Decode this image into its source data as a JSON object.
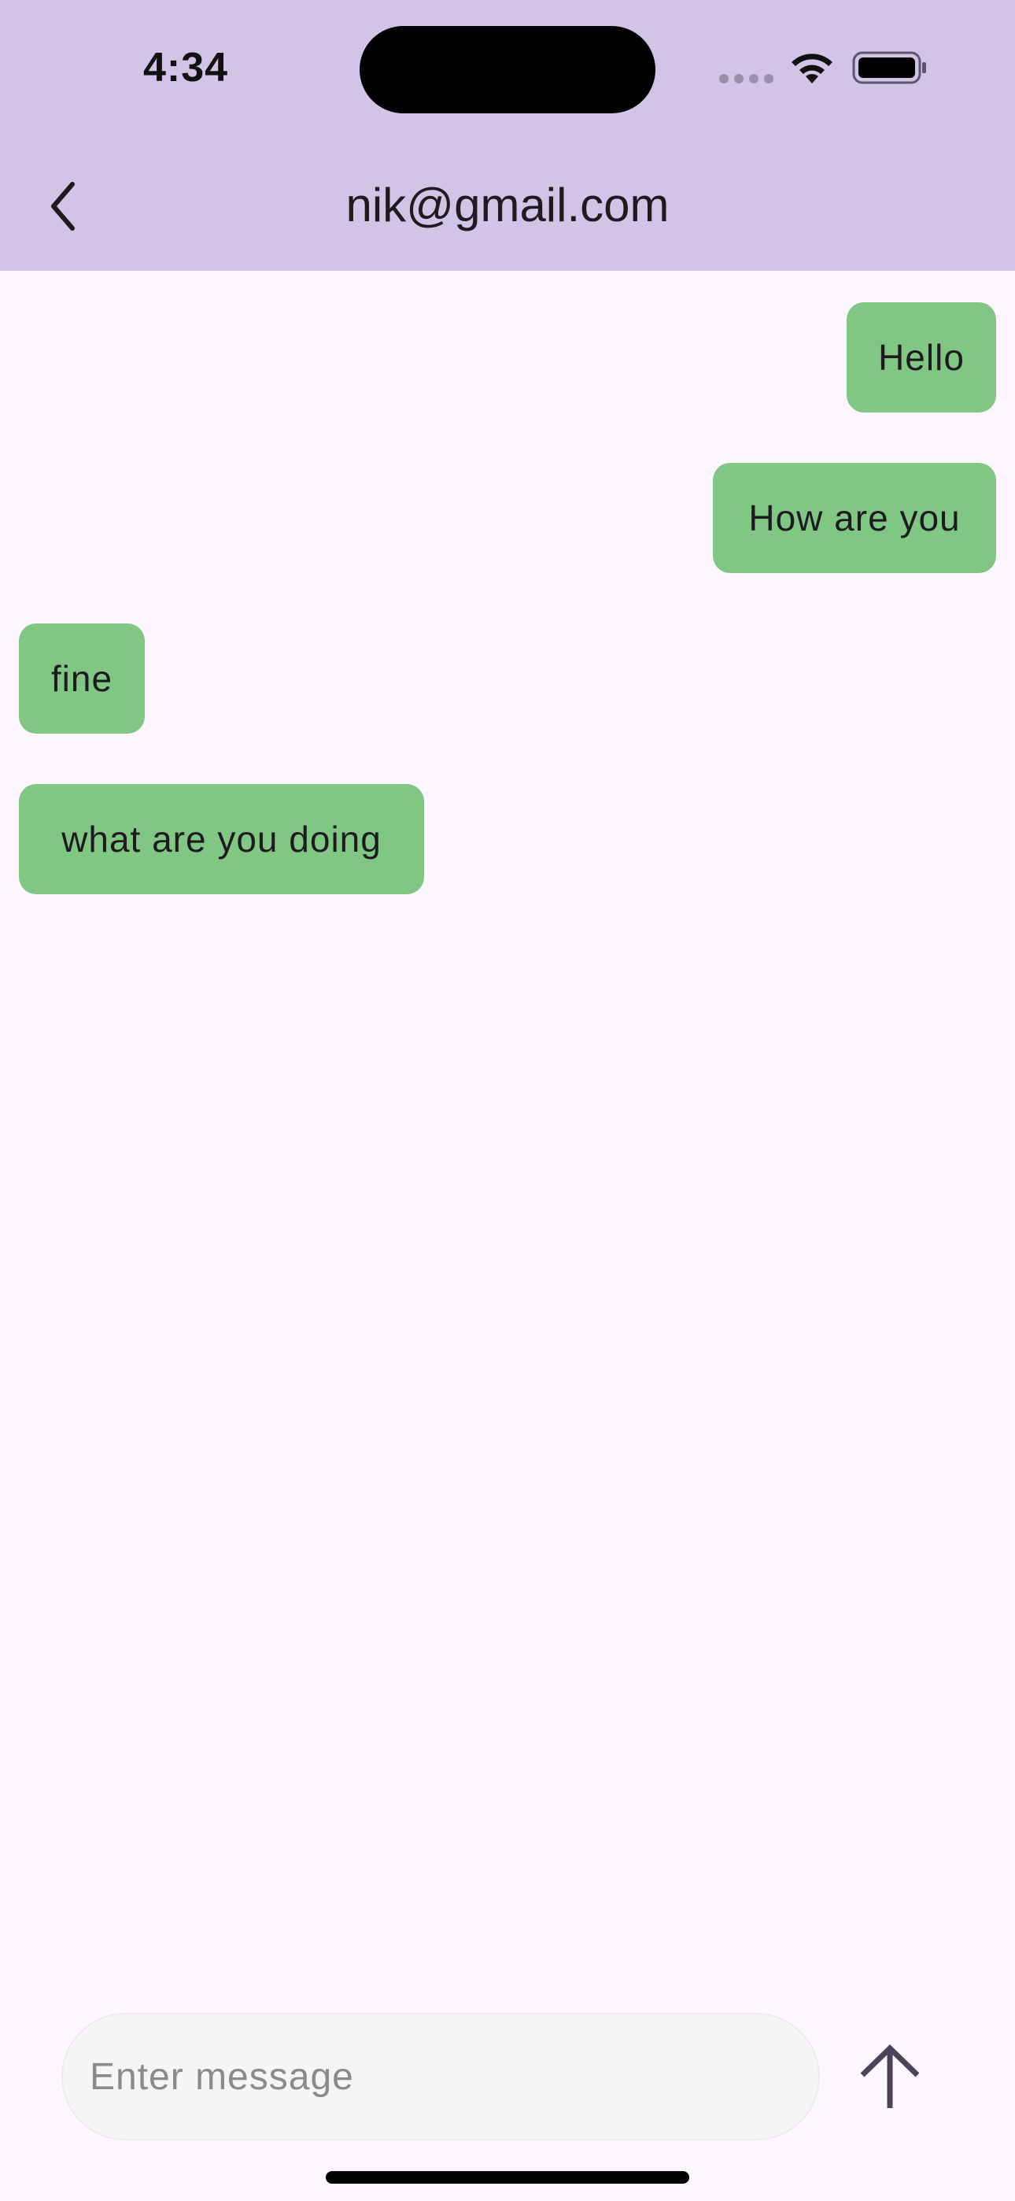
{
  "status_bar": {
    "time": "4:34"
  },
  "header": {
    "title": "nik@gmail.com",
    "back_icon": "chevron-left-icon",
    "background_color": "#d2c4e7"
  },
  "messages": [
    {
      "text": "Hello",
      "side": "sent"
    },
    {
      "text": "How are you",
      "side": "sent"
    },
    {
      "text": "fine",
      "side": "received"
    },
    {
      "text": "what are you doing",
      "side": "received"
    }
  ],
  "bubble_color": "#81c784",
  "composer": {
    "placeholder": "Enter message",
    "value": "",
    "send_icon": "arrow-up-icon"
  }
}
